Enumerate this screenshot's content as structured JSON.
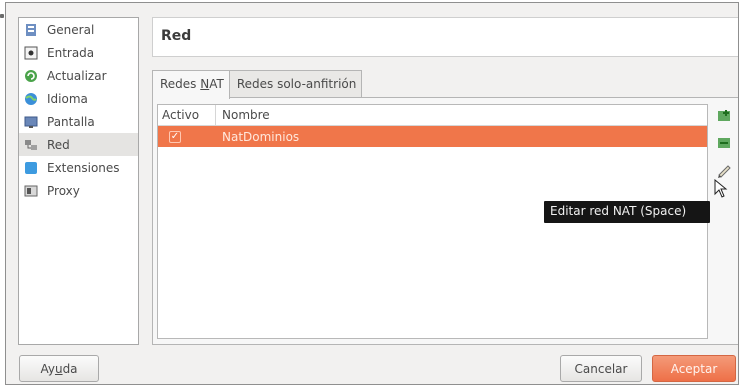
{
  "sidebar": {
    "items": [
      {
        "label": "General",
        "icon": "general-icon"
      },
      {
        "label": "Entrada",
        "icon": "input-icon"
      },
      {
        "label": "Actualizar",
        "icon": "update-icon"
      },
      {
        "label": "Idioma",
        "icon": "language-icon"
      },
      {
        "label": "Pantalla",
        "icon": "display-icon"
      },
      {
        "label": "Red",
        "icon": "network-icon",
        "selected": true
      },
      {
        "label": "Extensiones",
        "icon": "extensions-icon"
      },
      {
        "label": "Proxy",
        "icon": "proxy-icon"
      }
    ]
  },
  "header": {
    "title": "Red"
  },
  "tabs": [
    {
      "prefix": "Redes ",
      "mnemonic": "N",
      "suffix": "AT",
      "active": true
    },
    {
      "label": "Redes solo-anfitrión",
      "active": false
    }
  ],
  "table": {
    "columns": [
      "Activo",
      "Nombre"
    ],
    "rows": [
      {
        "active": true,
        "check_glyph": "✓",
        "name": "NatDominios",
        "selected": true
      }
    ]
  },
  "toolbar": {
    "buttons": [
      "add-nat-network-icon",
      "remove-nat-network-icon",
      "edit-nat-network-icon"
    ]
  },
  "tooltip": {
    "text": "Editar red NAT (Space)"
  },
  "footer": {
    "help": {
      "prefix": "Ay",
      "mnemonic": "u",
      "suffix": "da"
    },
    "cancel": {
      "label": "Cancelar"
    },
    "ok": {
      "label": "Aceptar"
    }
  },
  "colors": {
    "selection": "#f0764a",
    "accent_button": "#ee7048",
    "tooltip_bg": "#151515"
  }
}
